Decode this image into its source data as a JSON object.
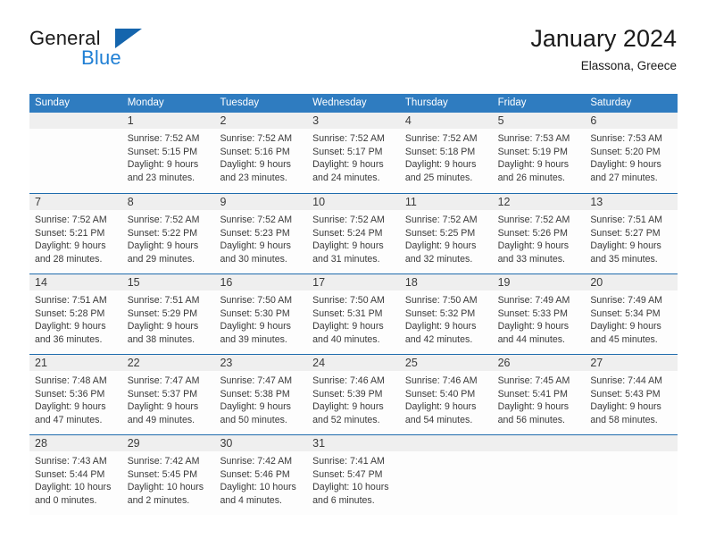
{
  "brand": {
    "name_dark": "General",
    "name_blue": "Blue",
    "triangle_color": "#1565ad",
    "blue_color": "#1f7fd4"
  },
  "header": {
    "title": "January 2024",
    "subtitle": "Elassona, Greece"
  },
  "colors": {
    "header_blue": "#2f7cc0",
    "row_divider": "#1f6cad",
    "date_band": "#efefef",
    "cell_background": "#fdfdfd",
    "text": "#3a3a3a"
  },
  "calendar": {
    "weekday_headers": [
      "Sunday",
      "Monday",
      "Tuesday",
      "Wednesday",
      "Thursday",
      "Friday",
      "Saturday"
    ],
    "weeks": [
      [
        {
          "day": "",
          "lines": []
        },
        {
          "day": "1",
          "lines": [
            "Sunrise: 7:52 AM",
            "Sunset: 5:15 PM",
            "Daylight: 9 hours",
            "and 23 minutes."
          ]
        },
        {
          "day": "2",
          "lines": [
            "Sunrise: 7:52 AM",
            "Sunset: 5:16 PM",
            "Daylight: 9 hours",
            "and 23 minutes."
          ]
        },
        {
          "day": "3",
          "lines": [
            "Sunrise: 7:52 AM",
            "Sunset: 5:17 PM",
            "Daylight: 9 hours",
            "and 24 minutes."
          ]
        },
        {
          "day": "4",
          "lines": [
            "Sunrise: 7:52 AM",
            "Sunset: 5:18 PM",
            "Daylight: 9 hours",
            "and 25 minutes."
          ]
        },
        {
          "day": "5",
          "lines": [
            "Sunrise: 7:53 AM",
            "Sunset: 5:19 PM",
            "Daylight: 9 hours",
            "and 26 minutes."
          ]
        },
        {
          "day": "6",
          "lines": [
            "Sunrise: 7:53 AM",
            "Sunset: 5:20 PM",
            "Daylight: 9 hours",
            "and 27 minutes."
          ]
        }
      ],
      [
        {
          "day": "7",
          "lines": [
            "Sunrise: 7:52 AM",
            "Sunset: 5:21 PM",
            "Daylight: 9 hours",
            "and 28 minutes."
          ]
        },
        {
          "day": "8",
          "lines": [
            "Sunrise: 7:52 AM",
            "Sunset: 5:22 PM",
            "Daylight: 9 hours",
            "and 29 minutes."
          ]
        },
        {
          "day": "9",
          "lines": [
            "Sunrise: 7:52 AM",
            "Sunset: 5:23 PM",
            "Daylight: 9 hours",
            "and 30 minutes."
          ]
        },
        {
          "day": "10",
          "lines": [
            "Sunrise: 7:52 AM",
            "Sunset: 5:24 PM",
            "Daylight: 9 hours",
            "and 31 minutes."
          ]
        },
        {
          "day": "11",
          "lines": [
            "Sunrise: 7:52 AM",
            "Sunset: 5:25 PM",
            "Daylight: 9 hours",
            "and 32 minutes."
          ]
        },
        {
          "day": "12",
          "lines": [
            "Sunrise: 7:52 AM",
            "Sunset: 5:26 PM",
            "Daylight: 9 hours",
            "and 33 minutes."
          ]
        },
        {
          "day": "13",
          "lines": [
            "Sunrise: 7:51 AM",
            "Sunset: 5:27 PM",
            "Daylight: 9 hours",
            "and 35 minutes."
          ]
        }
      ],
      [
        {
          "day": "14",
          "lines": [
            "Sunrise: 7:51 AM",
            "Sunset: 5:28 PM",
            "Daylight: 9 hours",
            "and 36 minutes."
          ]
        },
        {
          "day": "15",
          "lines": [
            "Sunrise: 7:51 AM",
            "Sunset: 5:29 PM",
            "Daylight: 9 hours",
            "and 38 minutes."
          ]
        },
        {
          "day": "16",
          "lines": [
            "Sunrise: 7:50 AM",
            "Sunset: 5:30 PM",
            "Daylight: 9 hours",
            "and 39 minutes."
          ]
        },
        {
          "day": "17",
          "lines": [
            "Sunrise: 7:50 AM",
            "Sunset: 5:31 PM",
            "Daylight: 9 hours",
            "and 40 minutes."
          ]
        },
        {
          "day": "18",
          "lines": [
            "Sunrise: 7:50 AM",
            "Sunset: 5:32 PM",
            "Daylight: 9 hours",
            "and 42 minutes."
          ]
        },
        {
          "day": "19",
          "lines": [
            "Sunrise: 7:49 AM",
            "Sunset: 5:33 PM",
            "Daylight: 9 hours",
            "and 44 minutes."
          ]
        },
        {
          "day": "20",
          "lines": [
            "Sunrise: 7:49 AM",
            "Sunset: 5:34 PM",
            "Daylight: 9 hours",
            "and 45 minutes."
          ]
        }
      ],
      [
        {
          "day": "21",
          "lines": [
            "Sunrise: 7:48 AM",
            "Sunset: 5:36 PM",
            "Daylight: 9 hours",
            "and 47 minutes."
          ]
        },
        {
          "day": "22",
          "lines": [
            "Sunrise: 7:47 AM",
            "Sunset: 5:37 PM",
            "Daylight: 9 hours",
            "and 49 minutes."
          ]
        },
        {
          "day": "23",
          "lines": [
            "Sunrise: 7:47 AM",
            "Sunset: 5:38 PM",
            "Daylight: 9 hours",
            "and 50 minutes."
          ]
        },
        {
          "day": "24",
          "lines": [
            "Sunrise: 7:46 AM",
            "Sunset: 5:39 PM",
            "Daylight: 9 hours",
            "and 52 minutes."
          ]
        },
        {
          "day": "25",
          "lines": [
            "Sunrise: 7:46 AM",
            "Sunset: 5:40 PM",
            "Daylight: 9 hours",
            "and 54 minutes."
          ]
        },
        {
          "day": "26",
          "lines": [
            "Sunrise: 7:45 AM",
            "Sunset: 5:41 PM",
            "Daylight: 9 hours",
            "and 56 minutes."
          ]
        },
        {
          "day": "27",
          "lines": [
            "Sunrise: 7:44 AM",
            "Sunset: 5:43 PM",
            "Daylight: 9 hours",
            "and 58 minutes."
          ]
        }
      ],
      [
        {
          "day": "28",
          "lines": [
            "Sunrise: 7:43 AM",
            "Sunset: 5:44 PM",
            "Daylight: 10 hours",
            "and 0 minutes."
          ]
        },
        {
          "day": "29",
          "lines": [
            "Sunrise: 7:42 AM",
            "Sunset: 5:45 PM",
            "Daylight: 10 hours",
            "and 2 minutes."
          ]
        },
        {
          "day": "30",
          "lines": [
            "Sunrise: 7:42 AM",
            "Sunset: 5:46 PM",
            "Daylight: 10 hours",
            "and 4 minutes."
          ]
        },
        {
          "day": "31",
          "lines": [
            "Sunrise: 7:41 AM",
            "Sunset: 5:47 PM",
            "Daylight: 10 hours",
            "and 6 minutes."
          ]
        },
        {
          "day": "",
          "lines": []
        },
        {
          "day": "",
          "lines": []
        },
        {
          "day": "",
          "lines": []
        }
      ]
    ]
  }
}
